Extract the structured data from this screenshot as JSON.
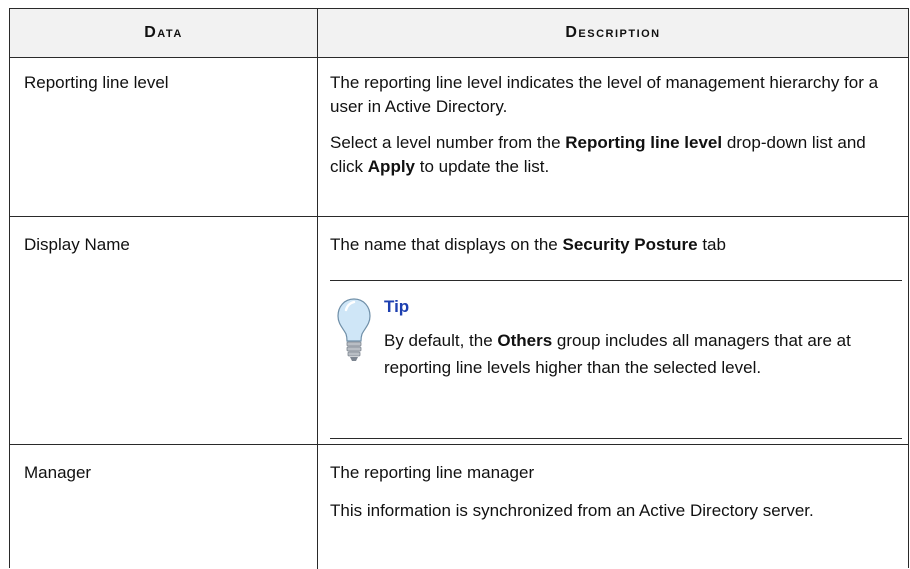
{
  "header": {
    "col1": "Data",
    "col2": "Description"
  },
  "rows": [
    {
      "name": "Reporting line level",
      "para1": "The reporting line level indicates the level of management hierarchy for a user in Active Directory.",
      "para2": {
        "t1": "Select a level number from the ",
        "b1": "Reporting line level",
        "t2": " drop-down list and click ",
        "b2": "Apply",
        "t3": " to update the list."
      }
    },
    {
      "name": "Display Name",
      "para1": {
        "t1": "The name that displays on the ",
        "b1": "Security Posture",
        "t2": " tab"
      },
      "tip": {
        "title": "Tip",
        "t1": "By default, the ",
        "b1": "Others",
        "t2": " group includes all managers that are at reporting line levels higher than the selected level."
      }
    },
    {
      "name": "Manager",
      "para1": "The reporting line manager",
      "para2": "This information is synchronized from an Active Directory server."
    }
  ],
  "colors": {
    "header_bg": "#f2f2f2",
    "tip_title": "#1d3fb0",
    "bulb_fill": "#cfe6f7"
  },
  "icons": {
    "tip": "lightbulb-icon"
  }
}
